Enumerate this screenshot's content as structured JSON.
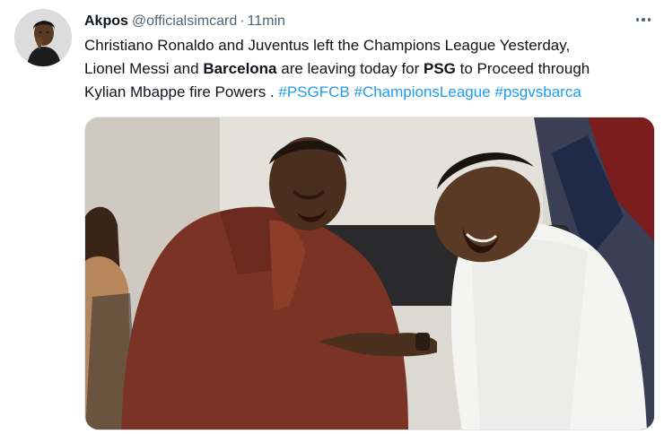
{
  "tweet": {
    "author_name": "Akpos",
    "handle": "@officialsimcard",
    "separator": "·",
    "time": "11min",
    "text": {
      "line1": "Christiano Ronaldo and Juventus left the Champions League Yesterday,",
      "line2_a": "Lionel Messi and ",
      "line2_bold1": "Barcelona",
      "line2_b": " are leaving today for ",
      "line2_bold2": "PSG",
      "line2_c": " to Proceed through",
      "line3_a": "Kylian Mbappe fire Powers . ",
      "hashtag1": "#PSGFCB",
      "hashtag2": "#ChampionsLeague",
      "hashtag3": "#psgvsbarca"
    }
  },
  "icons": {
    "more": "more-horizontal-icon"
  },
  "colors": {
    "link": "#1d9bf0",
    "secondary_text": "#536471",
    "primary_text": "#0f1419"
  }
}
